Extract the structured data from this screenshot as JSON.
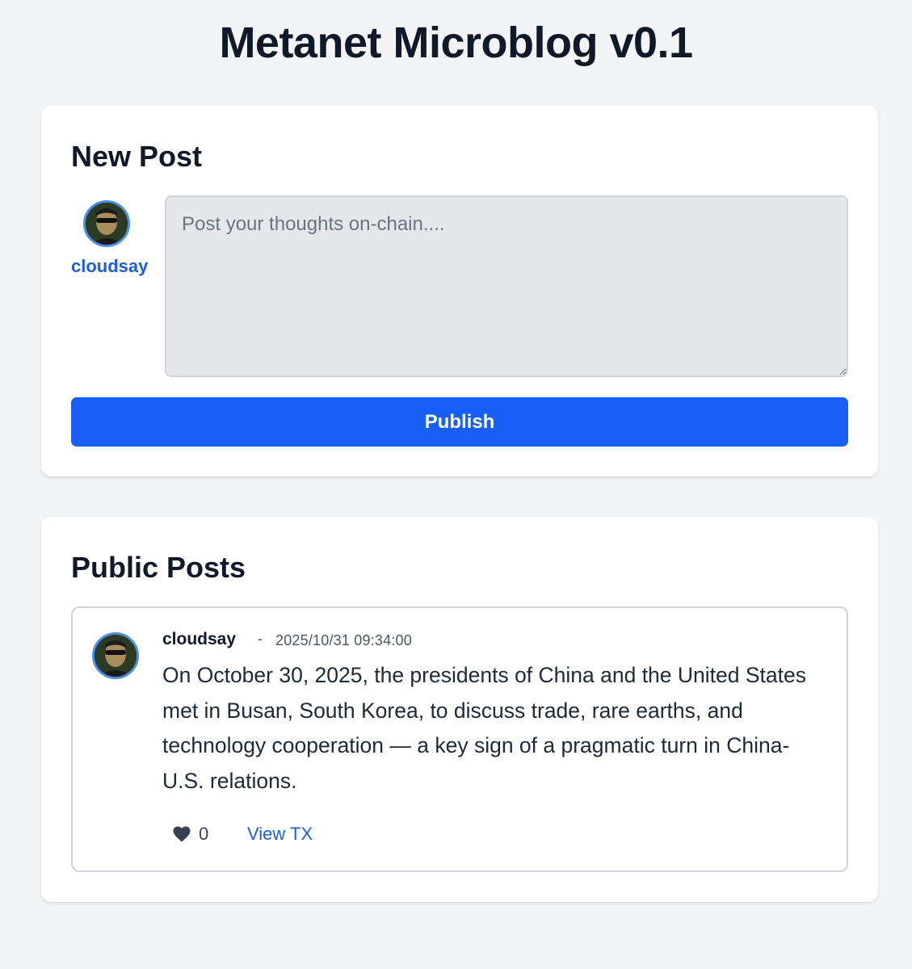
{
  "app": {
    "title": "Metanet Microblog v0.1"
  },
  "composer": {
    "heading": "New Post",
    "username": "cloudsay",
    "placeholder": "Post your thoughts on-chain....",
    "value": "",
    "publish_label": "Publish"
  },
  "feed": {
    "heading": "Public Posts",
    "posts": [
      {
        "author": "cloudsay",
        "separator": "-",
        "timestamp": "2025/10/31 09:34:00",
        "body": "On October 30, 2025, the presidents of China and the United States met in Busan, South Korea, to discuss trade, rare earths, and technology cooperation — a key sign of a pragmatic turn in China-U.S. relations.",
        "likes": "0",
        "view_tx_label": "View TX",
        "icons": [
          "avatar-icon",
          "heart-icon"
        ]
      }
    ]
  },
  "colors": {
    "background": "#f3f4f6",
    "accent": "#1a5ff5",
    "link": "#1d5fd6",
    "avatar_border": "#4a8fe7"
  }
}
